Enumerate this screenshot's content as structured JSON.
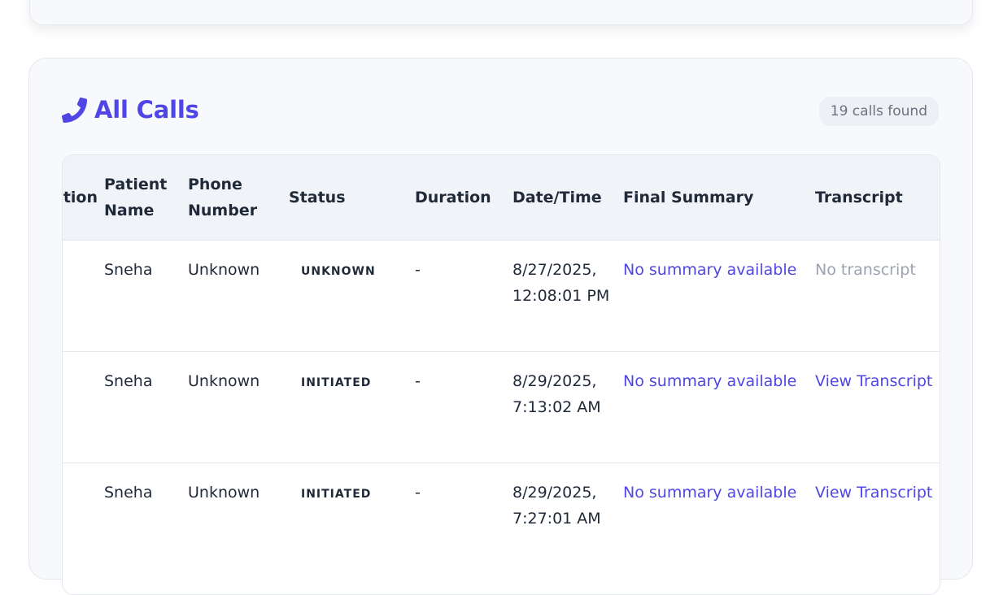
{
  "header": {
    "title": "All Calls",
    "count_label": "19 calls found"
  },
  "columns": [
    "Duration",
    "Patient Name",
    "Phone Number",
    "Status",
    "Duration",
    "Date/Time",
    "Final Summary",
    "Transcript"
  ],
  "rows": [
    {
      "patient": "Sneha",
      "phone": "Unknown",
      "status": "UNKNOWN",
      "duration": "-",
      "datetime": "8/27/2025, 12:08:01 PM",
      "summary": "No summary available",
      "transcript": "No transcript",
      "transcript_available": false
    },
    {
      "patient": "Sneha",
      "phone": "Unknown",
      "status": "INITIATED",
      "duration": "-",
      "datetime": "8/29/2025, 7:13:02 AM",
      "summary": "No summary available",
      "transcript": "View Transcript",
      "transcript_available": true
    },
    {
      "patient": "Sneha",
      "phone": "Unknown",
      "status": "INITIATED",
      "duration": "-",
      "datetime": "8/29/2025, 7:27:01 AM",
      "summary": "No summary available",
      "transcript": "View Transcript",
      "transcript_available": true
    }
  ],
  "colors": {
    "accent": "#4f46e5",
    "muted": "#9ca3af",
    "header_bg": "#f0f3f8",
    "card_bg": "#f8f9fc"
  },
  "icons": {
    "title_icon": "phone-icon"
  }
}
